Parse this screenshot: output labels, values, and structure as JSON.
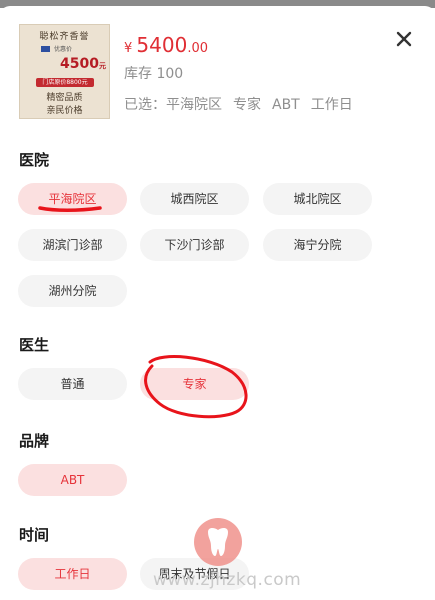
{
  "product": {
    "thumbnail": {
      "title": "聪松齐香誉",
      "subtitle": "优惠价",
      "price": "4500",
      "price_unit": "元",
      "tag": "门店原价8800元",
      "line1": "精密品质",
      "line2": "亲民价格"
    },
    "price_symbol": "¥",
    "price_integer": "5400",
    "price_decimal": ".00",
    "stock_text": "库存 100",
    "selected_label": "已选：",
    "selected_values": [
      "平海院区",
      "专家",
      "ABT",
      "工作日"
    ]
  },
  "sections": {
    "hospital": {
      "title": "医院",
      "options": [
        "平海院区",
        "城西院区",
        "城北院区",
        "湖滨门诊部",
        "下沙门诊部",
        "海宁分院",
        "湖州分院"
      ],
      "selected": "平海院区"
    },
    "doctor": {
      "title": "医生",
      "options": [
        "普通",
        "专家"
      ],
      "selected": "专家"
    },
    "brand": {
      "title": "品牌",
      "options": [
        "ABT"
      ],
      "selected": "ABT"
    },
    "time": {
      "title": "时间",
      "options": [
        "工作日",
        "周末及节假日"
      ],
      "selected": "工作日"
    }
  },
  "icons": {
    "close": "close-icon",
    "watermark": "tooth-icon"
  },
  "colors": {
    "accent": "#e02e34",
    "chip_active_bg": "#fbe0e0",
    "chip_bg": "#f4f4f4",
    "annotation": "#e8141b"
  },
  "watermark_text": "www.zjhzkq.com"
}
